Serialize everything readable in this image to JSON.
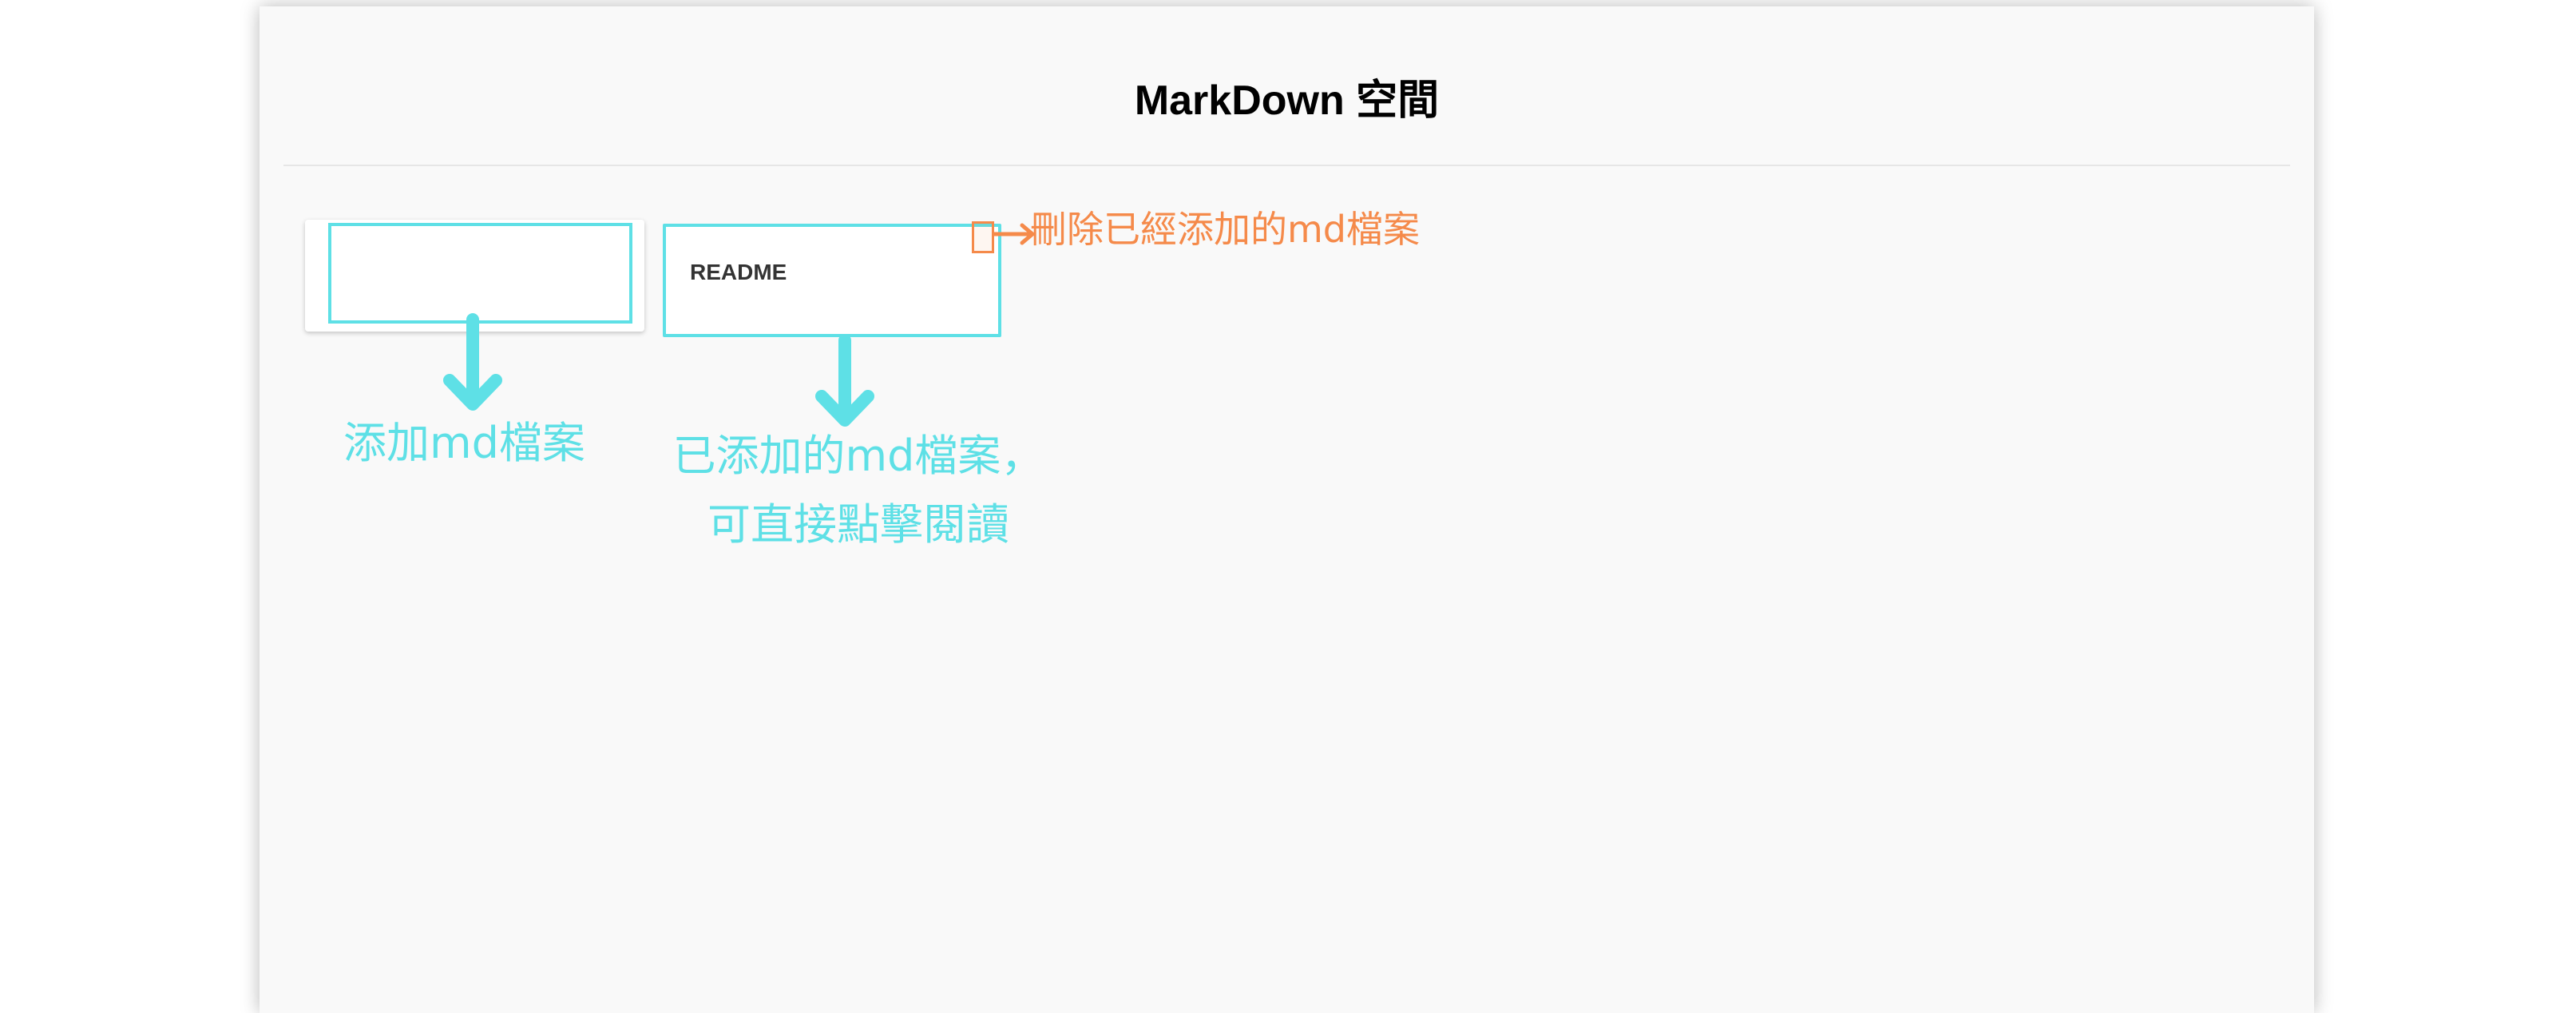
{
  "header": {
    "title": "MarkDown 空間"
  },
  "cards": {
    "add": {
      "icon": "plus-circle-icon"
    },
    "readme": {
      "label": "README"
    },
    "delete_icon": "trash-icon"
  },
  "annotations": {
    "delete_hint": "刪除已經添加的md檔案",
    "add_hint": "添加md檔案",
    "added_hint_line1": "已添加的md檔案，",
    "added_hint_line2": "可直接點擊閱讀"
  },
  "colors": {
    "page_bg": "#f9f9f9",
    "card_bg": "#ffffff",
    "annotation_cyan": "#5ee0e6",
    "annotation_orange": "#f58a4a",
    "title_text": "#000000"
  }
}
